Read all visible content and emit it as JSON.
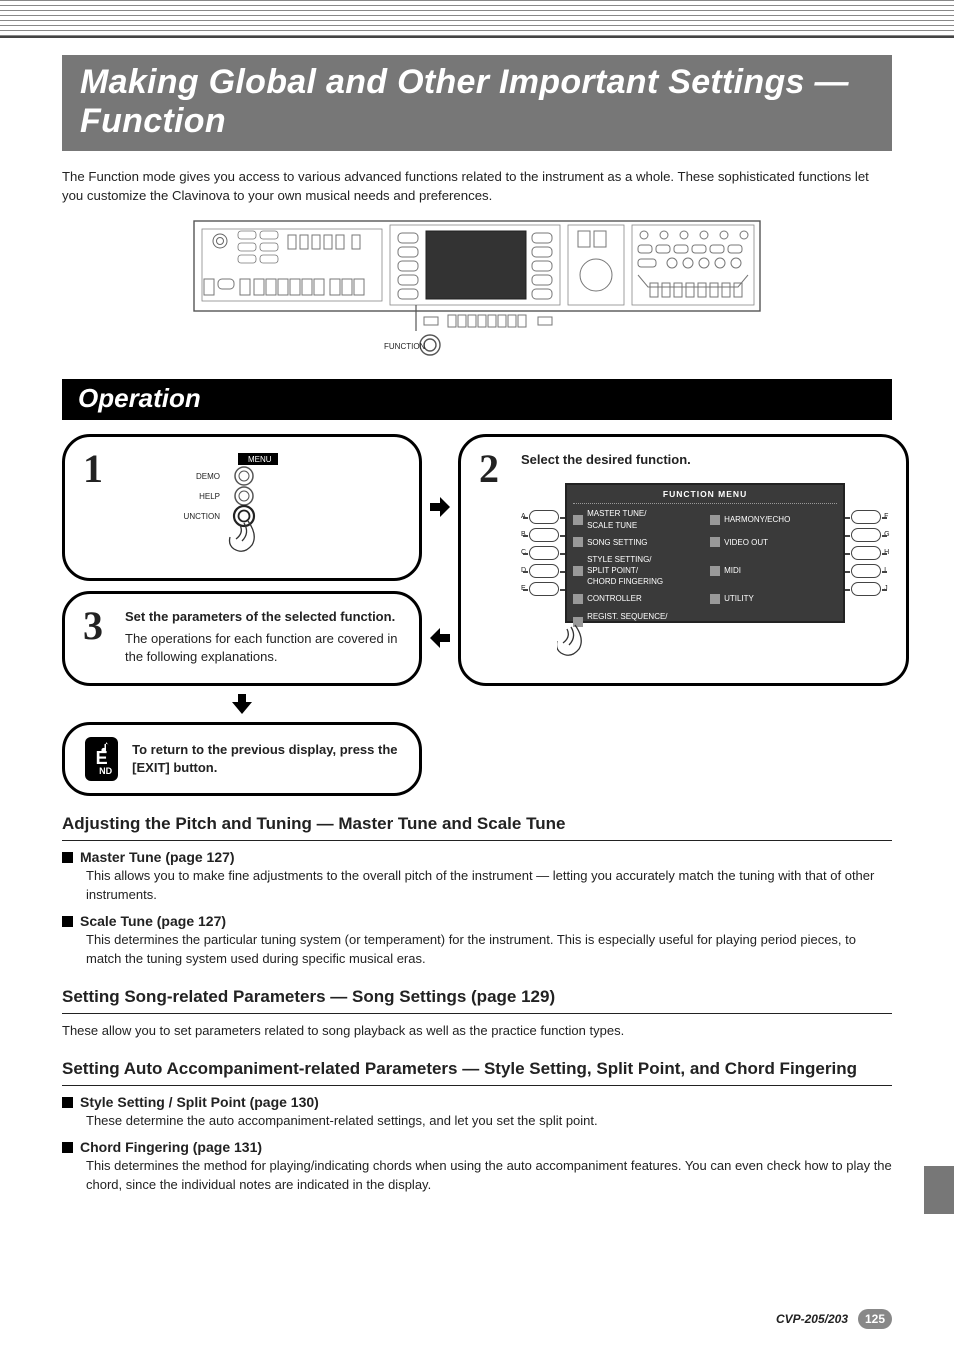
{
  "page": {
    "title": "Making Global and Other Important Settings — Function",
    "intro": "The Function mode gives you access to various advanced functions related to the instrument as a whole. These sophisticated functions let you customize the Clavinova to your own musical needs and preferences.",
    "function_btn_label": "FUNCTION"
  },
  "operation": {
    "heading": "Operation",
    "step1": {
      "num": "1",
      "menu_label": "MENU",
      "items": [
        "DEMO",
        "HELP",
        "FUNCTION"
      ]
    },
    "step2": {
      "num": "2",
      "title": "Select the desired function.",
      "screen_title": "FUNCTION MENU",
      "left_items": [
        "MASTER TUNE/\nSCALE TUNE",
        "SONG SETTING",
        "STYLE SETTING/\nSPLIT POINT/\nCHORD FINGERING",
        "CONTROLLER",
        "REGIST. SEQUENCE/\nFREEZE/VOICE SET"
      ],
      "right_items": [
        "HARMONY/ECHO",
        "VIDEO OUT",
        "MIDI",
        "UTILITY"
      ],
      "left_btn_labels": [
        "A",
        "B",
        "C",
        "D",
        "E"
      ],
      "right_btn_labels": [
        "F",
        "G",
        "H",
        "I",
        "J"
      ]
    },
    "step3": {
      "num": "3",
      "title": "Set the parameters of the selected function.",
      "body": "The operations for each function are covered in the following explanations."
    },
    "end": {
      "icon_text": "E",
      "icon_sub": "ND",
      "text": "To return to the previous display, press the [EXIT] button."
    }
  },
  "sections": {
    "s1": {
      "heading": "Adjusting the Pitch and Tuning — Master Tune and Scale Tune",
      "items": [
        {
          "label": "Master Tune (page 127)",
          "body": "This allows you to make fine adjustments to the overall pitch of the instrument — letting you accurately match the tuning with that of other instruments."
        },
        {
          "label": "Scale Tune (page 127)",
          "body": "This determines the particular tuning system (or temperament) for the instrument. This is especially useful for playing period pieces, to match the tuning system used during specific musical eras."
        }
      ]
    },
    "s2": {
      "heading": "Setting Song-related Parameters — Song Settings (page 129)",
      "body": "These allow you to set parameters related to song playback as well as the practice function types."
    },
    "s3": {
      "heading": "Setting Auto Accompaniment-related Parameters — Style Setting, Split Point, and Chord Fingering",
      "items": [
        {
          "label": "Style Setting / Split Point (page 130)",
          "body": "These determine the auto accompaniment-related settings, and let you set the split point."
        },
        {
          "label": "Chord Fingering (page 131)",
          "body": "This determines the method for playing/indicating chords when using the auto accompaniment features. You can even check how to play the chord, since the individual notes are indicated in the display."
        }
      ]
    }
  },
  "footer": {
    "model": "CVP-205/203",
    "page_num": "125"
  }
}
